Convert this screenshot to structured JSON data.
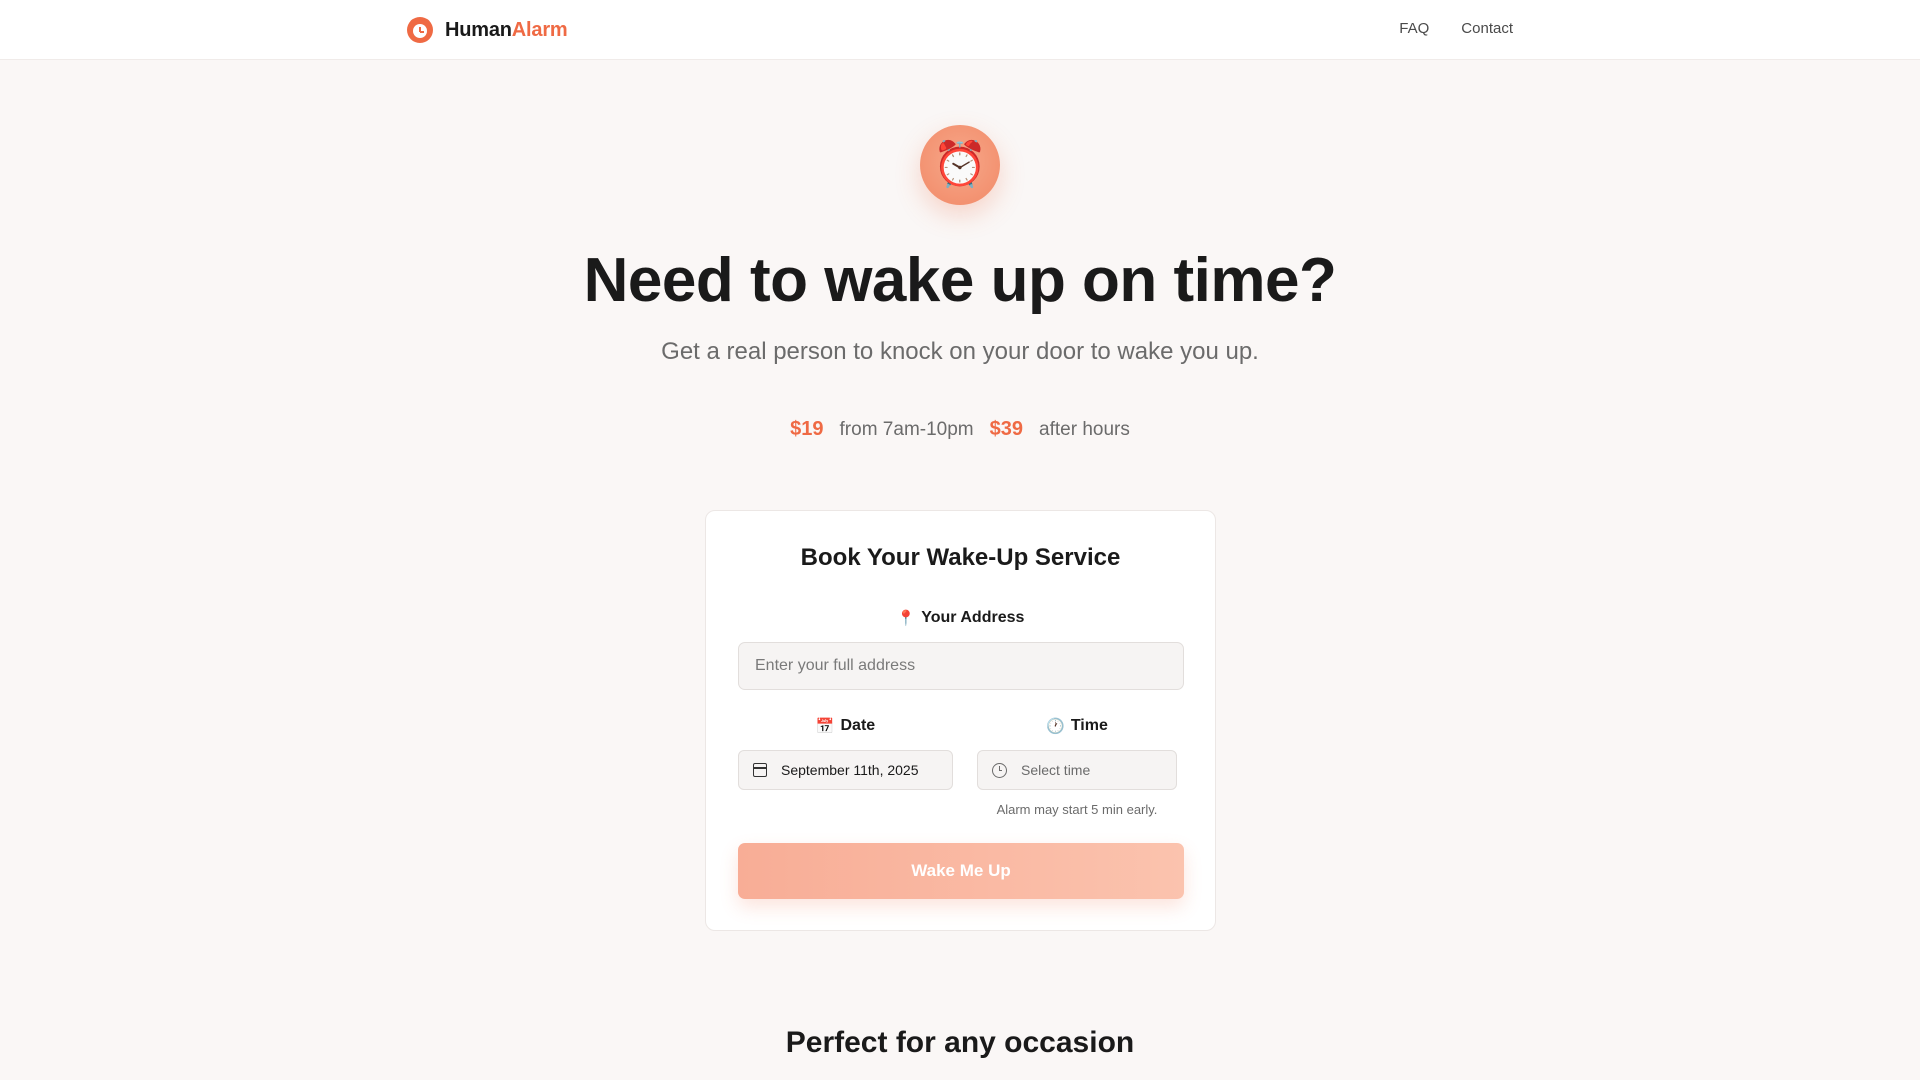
{
  "header": {
    "brand_part1": "Human",
    "brand_part2": "Alarm",
    "nav": [
      {
        "label": "FAQ"
      },
      {
        "label": "Contact"
      }
    ]
  },
  "hero": {
    "icon": "⏰",
    "title": "Need to wake up on time?",
    "subtitle": "Get a real person to knock on your door to wake you up.",
    "pricing": {
      "price1": "$19",
      "desc1": "from 7am-10pm",
      "price2": "$39",
      "desc2": "after hours"
    }
  },
  "form": {
    "title": "Book Your Wake-Up Service",
    "address_icon": "📍",
    "address_label": "Your Address",
    "address_placeholder": "Enter your full address",
    "address_value": "",
    "date_icon": "📅",
    "date_label": "Date",
    "date_value": "September 11th, 2025",
    "time_icon": "🕐",
    "time_label": "Time",
    "time_placeholder": "Select time",
    "time_note": "Alarm may start 5 min early.",
    "submit_label": "Wake Me Up"
  },
  "sections": {
    "occasion_title": "Perfect for any occasion"
  },
  "colors": {
    "accent": "#ef6a44",
    "button_start": "#f8ad96",
    "button_end": "#fbc3ae",
    "background": "#faf7f6"
  }
}
